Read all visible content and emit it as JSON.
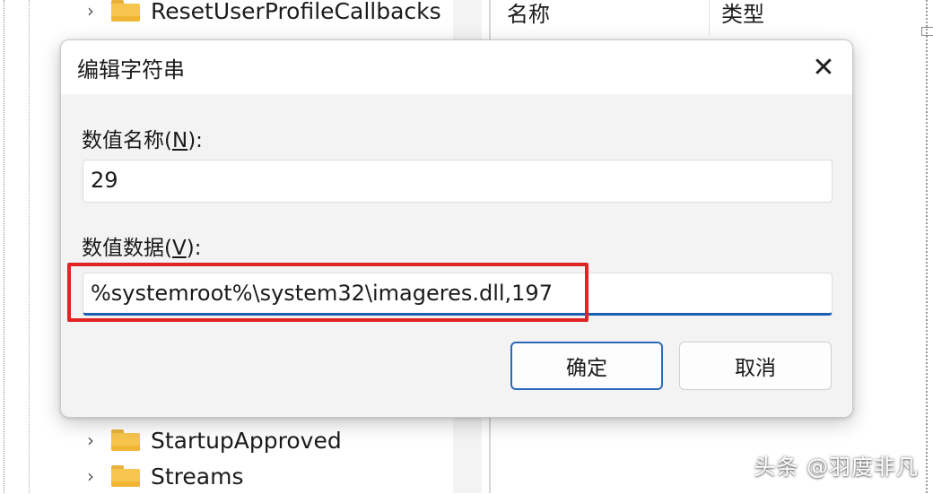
{
  "registry": {
    "tree_items": [
      {
        "label": "ResetUserProfileCallbacks",
        "chevron": "›",
        "icon": "folder-icon"
      },
      {
        "label": "StartupApproved",
        "chevron": "›",
        "icon": "folder-icon"
      },
      {
        "label": "Streams",
        "chevron": "›",
        "icon": "folder-icon"
      }
    ],
    "columns": {
      "name": "名称",
      "type": "类型"
    }
  },
  "dialog": {
    "title": "编辑字符串",
    "close_glyph": "✕",
    "value_name": {
      "label": "数值名称(",
      "accel": "N",
      "label_end": "):",
      "value": "29"
    },
    "value_data": {
      "label": "数值数据(",
      "accel": "V",
      "label_end": "):",
      "value": "%systemroot%\\system32\\imageres.dll,197"
    },
    "ok_label": "确定",
    "cancel_label": "取消"
  },
  "colors": {
    "highlight": "#e02424",
    "accent": "#1b5fb4",
    "folder": "#f6c54d"
  },
  "watermark": "头条 @羽度非凡"
}
